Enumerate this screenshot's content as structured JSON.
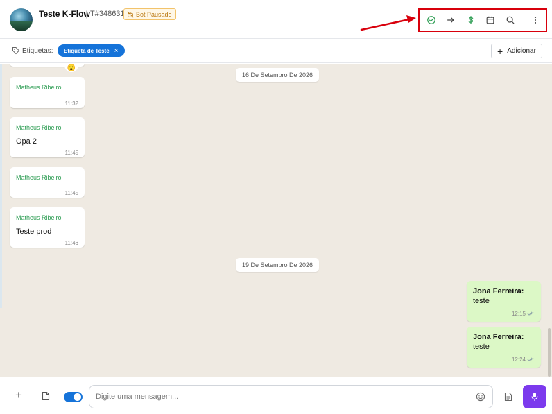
{
  "header": {
    "title": "Teste K-Flow",
    "separator": "|",
    "ticket": "T#348631",
    "bot_badge": "Bot Pausado",
    "actions": [
      "check-circle-icon",
      "arrow-right-icon",
      "dollar-icon",
      "calendar-icon",
      "search-icon",
      "more-vertical-icon"
    ]
  },
  "tags": {
    "label": "Etiquetas:",
    "chip": "Etiqueta de Teste",
    "chip_remove": "×",
    "add_button": "Adicionar"
  },
  "chat": {
    "dates": [
      "16 De Setembro De 2026",
      "19 De Setembro De 2026"
    ],
    "reaction": "😮",
    "incoming": [
      {
        "sender": "Matheus Ribeiro",
        "text": "",
        "time": "11:32"
      },
      {
        "sender": "Matheus Ribeiro",
        "text": "Opa 2",
        "time": "11:45"
      },
      {
        "sender": "Matheus Ribeiro",
        "text": "",
        "time": "11:45"
      },
      {
        "sender": "Matheus Ribeiro",
        "text": "Teste prod",
        "time": "11:46"
      }
    ],
    "outgoing": [
      {
        "sender": "Jona Ferreira:",
        "text": "teste",
        "time": "12:15"
      },
      {
        "sender": "Jona Ferreira:",
        "text": "teste",
        "time": "12:24"
      }
    ]
  },
  "composer": {
    "plus": "+",
    "placeholder": "Digite uma mensagem..."
  },
  "colors": {
    "accent": "#1573d9",
    "mic": "#7c3aed",
    "highlight": "#d8000c",
    "sender_green": "#2f9e55",
    "outgoing_bubble": "#dcf8c6",
    "chat_bg": "#efeae2"
  }
}
